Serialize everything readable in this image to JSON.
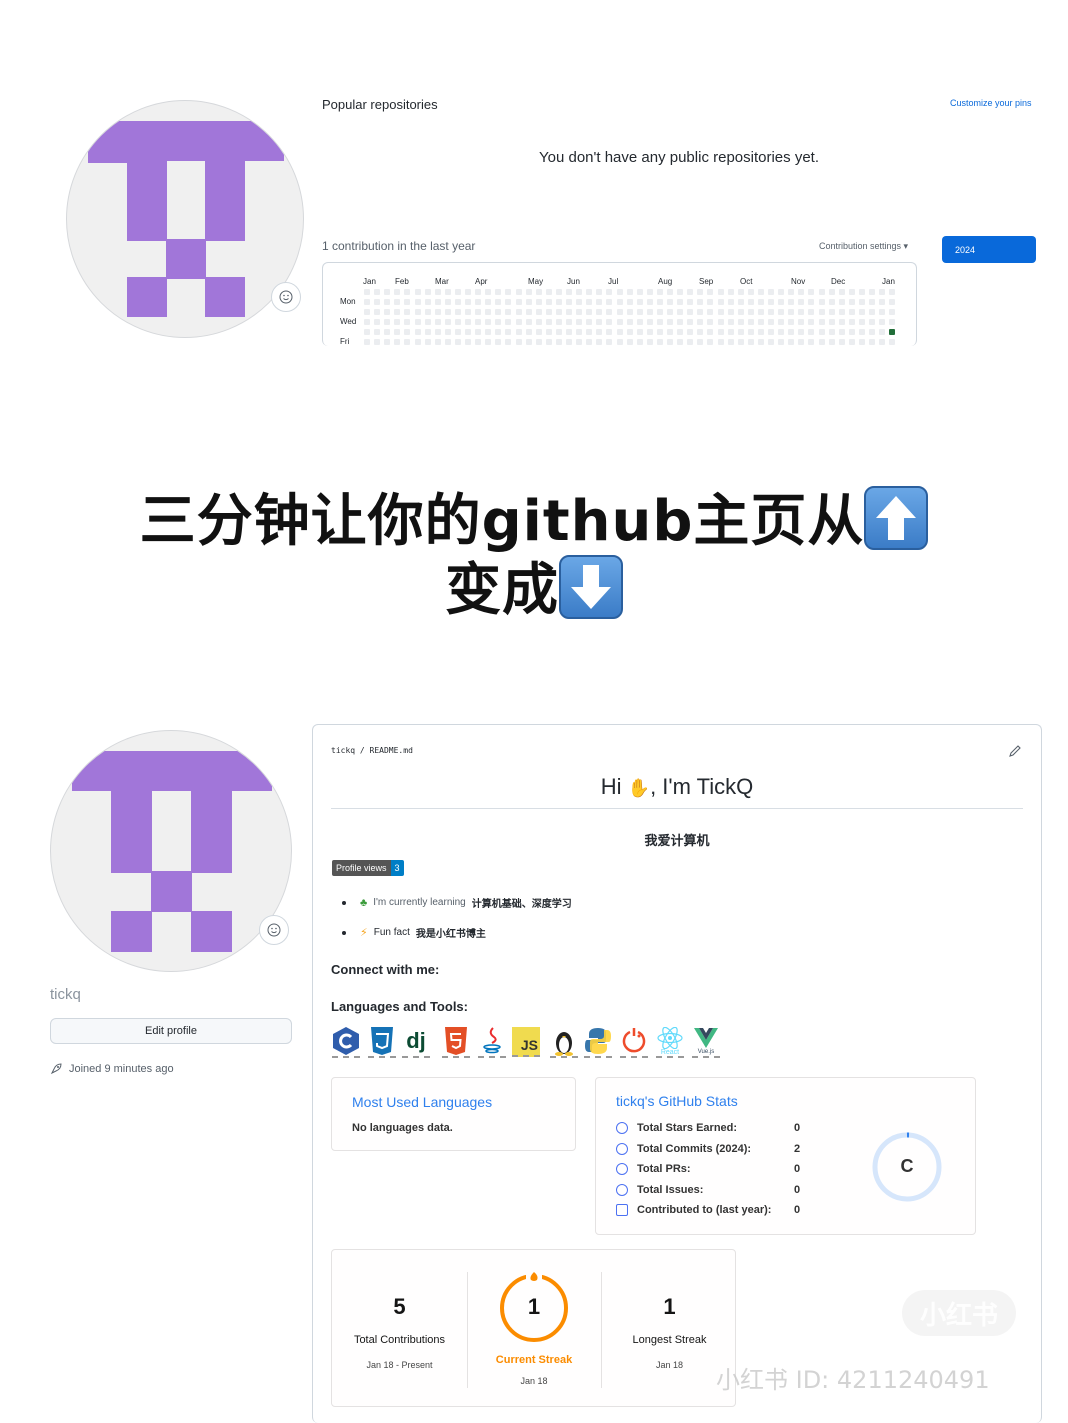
{
  "top": {
    "popular_title": "Popular repositories",
    "customize_pins": "Customize your pins",
    "no_repos": "You don't have any public repositories yet.",
    "contrib_summary": "1 contribution in the last year",
    "contrib_settings": "Contribution settings ▾",
    "year_button": "2024",
    "months": [
      "Jan",
      "Feb",
      "Mar",
      "Apr",
      "May",
      "Jun",
      "Jul",
      "Aug",
      "Sep",
      "Oct",
      "Nov",
      "Dec",
      "Jan"
    ],
    "days": [
      "Mon",
      "Wed",
      "Fri"
    ],
    "contribution_count": 1
  },
  "headline": {
    "line1": "三分钟让你的github主页从",
    "line2": "变成"
  },
  "profile": {
    "username": "tickq",
    "edit_button": "Edit profile",
    "joined": "Joined 9 minutes ago"
  },
  "readme": {
    "path": "tickq / README.md",
    "title_hi": "Hi",
    "title_name": ", I'm TickQ",
    "subtitle": "我爱计算机",
    "badge_label": "Profile views",
    "badge_value": "3",
    "learning_prefix": "I'm currently learning",
    "learning_value": "计算机基础、深度学习",
    "fun_prefix": "Fun fact",
    "fun_value": "我是小红书博主",
    "connect": "Connect with me:",
    "languages_tools": "Languages and Tools:",
    "tools": [
      "c",
      "css3",
      "django",
      "html5",
      "java",
      "javascript",
      "linux",
      "python",
      "pytorch",
      "react",
      "vuejs"
    ],
    "tool_text": {
      "js": "JS",
      "dj": "dj",
      "react": "React",
      "vue": "Vue.js",
      "css": "CSS",
      "html": "HTML"
    }
  },
  "lang_card": {
    "title": "Most Used Languages",
    "empty": "No languages data."
  },
  "stats_card": {
    "title": "tickq's GitHub Stats",
    "rows": [
      {
        "label": "Total Stars Earned:",
        "value": "0"
      },
      {
        "label": "Total Commits (2024):",
        "value": "2"
      },
      {
        "label": "Total PRs:",
        "value": "0"
      },
      {
        "label": "Total Issues:",
        "value": "0"
      },
      {
        "label": "Contributed to (last year):",
        "value": "0"
      }
    ],
    "rank": "C",
    "accent": "#2f80ed"
  },
  "streak_card": {
    "total_value": "5",
    "total_label": "Total Contributions",
    "total_range": "Jan 18 - Present",
    "current_value": "1",
    "current_label": "Current Streak",
    "current_date": "Jan 18",
    "longest_value": "1",
    "longest_label": "Longest Streak",
    "longest_date": "Jan 18",
    "accent": "#fb8c00"
  },
  "watermark": {
    "logo": "小红书",
    "id": "小红书 ID: 4211240491"
  },
  "colors": {
    "identicon": "#a176d9",
    "primary_button": "#0969da",
    "contrib_on": "#216e39"
  }
}
